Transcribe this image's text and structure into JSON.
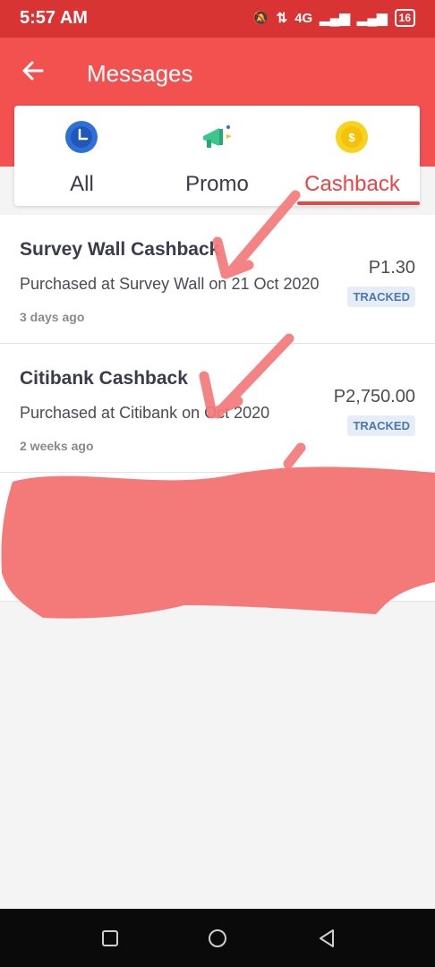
{
  "status_bar": {
    "time": "5:57 AM",
    "network": "4G",
    "battery": "16"
  },
  "header": {
    "title": "Messages"
  },
  "tabs": [
    {
      "label": "All",
      "icon": "clock-icon"
    },
    {
      "label": "Promo",
      "icon": "megaphone-icon"
    },
    {
      "label": "Cashback",
      "icon": "coin-icon",
      "active": true
    }
  ],
  "messages": [
    {
      "title": "Survey Wall Cashback",
      "description": "Purchased at Survey Wall on 21 Oct 2020",
      "time": "3 days ago",
      "amount": "P1.30",
      "status": "TRACKED"
    },
    {
      "title": "Citibank Cashback",
      "description": "Purchased at Citibank on   Oct 2020",
      "time": "2 weeks ago",
      "amount": "P2,750.00",
      "status": "TRACKED"
    }
  ],
  "colors": {
    "appbar": "#f35050",
    "accent": "#ea4444",
    "annotation": "#f47a7a"
  }
}
